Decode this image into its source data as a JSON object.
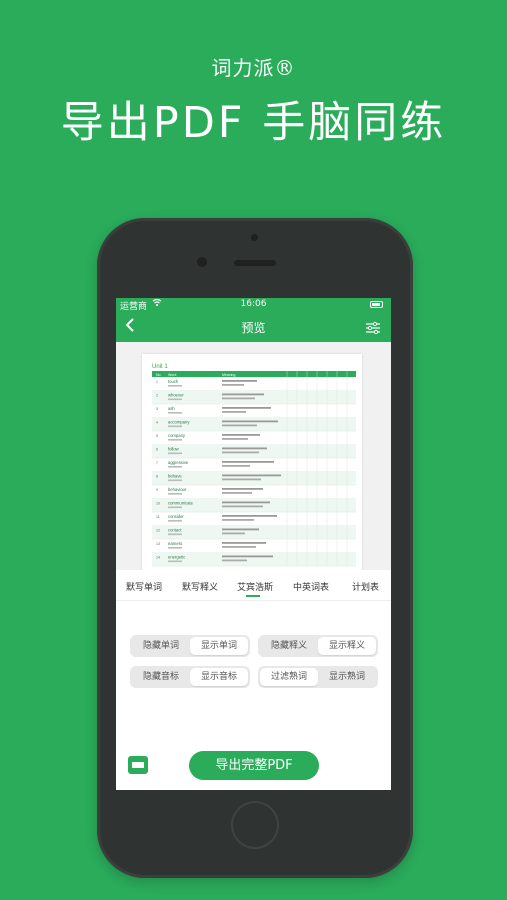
{
  "promo": {
    "brand": "词力派®",
    "headline": "导出PDF 手脑同练"
  },
  "status_bar": {
    "carrier": "运营商",
    "time": "16:06"
  },
  "nav": {
    "title": "预览",
    "back_icon": "chevron-left-icon",
    "filter_icon": "sliders-icon"
  },
  "pdf_preview": {
    "unit_title": "Unit 1",
    "headers": [
      "No.",
      "Word",
      "Meaning"
    ],
    "words": [
      "touch",
      "whoever",
      "ash",
      "accompany",
      "company",
      "follow",
      "aggressive",
      "behave",
      "behaviour",
      "communicate",
      "consider",
      "contact",
      "earnest",
      "energetic"
    ]
  },
  "tabs": [
    "默写单词",
    "默写释义",
    "艾宾浩斯",
    "中英词表",
    "计划表"
  ],
  "active_tab_index": 2,
  "toggles": {
    "word_group": [
      "隐藏单词",
      "显示单词"
    ],
    "meaning_group": [
      "隐藏释义",
      "显示释义"
    ],
    "phonetic_group": [
      "隐藏音标",
      "显示音标"
    ],
    "familiar_group": [
      "过滤熟词",
      "显示熟词"
    ]
  },
  "export_button": "导出完整PDF",
  "colors": {
    "brand_green": "#2aac5b",
    "phone_body": "#2f3331"
  }
}
